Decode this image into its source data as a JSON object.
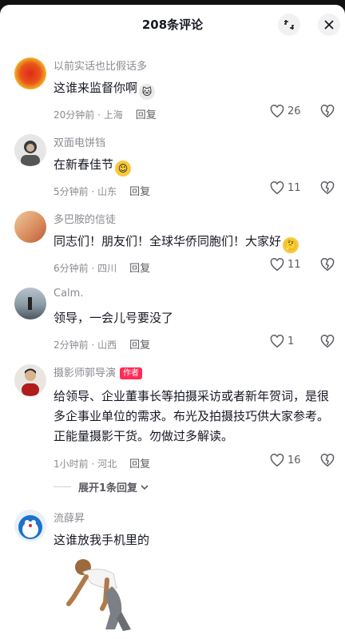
{
  "header": {
    "title": "208条评论"
  },
  "comments": [
    {
      "user": "以前实话也比假话多",
      "text": "这谁来监督你啊",
      "time": "20分钟前",
      "location": "上海",
      "reply": "回复",
      "likes": "26"
    },
    {
      "user": "双面电饼铛",
      "text": "在新春佳节",
      "time": "5分钟前",
      "location": "山东",
      "reply": "回复",
      "likes": "11"
    },
    {
      "user": "多巴胺的信徒",
      "text": "同志们！朋友们！全球华侨同胞们！大家好",
      "time": "6分钟前",
      "location": "四川",
      "reply": "回复",
      "likes": "11"
    },
    {
      "user": "Calm.",
      "text": "领导，一会儿号要没了",
      "time": "2分钟前",
      "location": "山西",
      "reply": "回复",
      "likes": "1"
    },
    {
      "user": "摄影师郭导演",
      "badge": "作者",
      "text": "给领导、企业董事长等拍摄采访或者新年贺词，是很多企事业单位的需求。布光及拍摄技巧供大家参考。正能量摄影干货。勿做过多解读。",
      "time": "1小时前",
      "location": "河北",
      "reply": "回复",
      "likes": "16"
    },
    {
      "user": "流薛昇",
      "text": "这谁放我手机里的"
    }
  ],
  "expand_replies": "展开1条回复",
  "separator": " · ",
  "icons": {
    "collapse": "collapse-icon",
    "close": "close-icon",
    "like": "heart-outline-icon",
    "dislike": "broken-heart-icon",
    "expand": "chevron-down-icon"
  },
  "colors": {
    "text": "#161823",
    "secondary": "#8a8b91",
    "badge": "#fe2c55",
    "divider": "#d0d0d3"
  }
}
